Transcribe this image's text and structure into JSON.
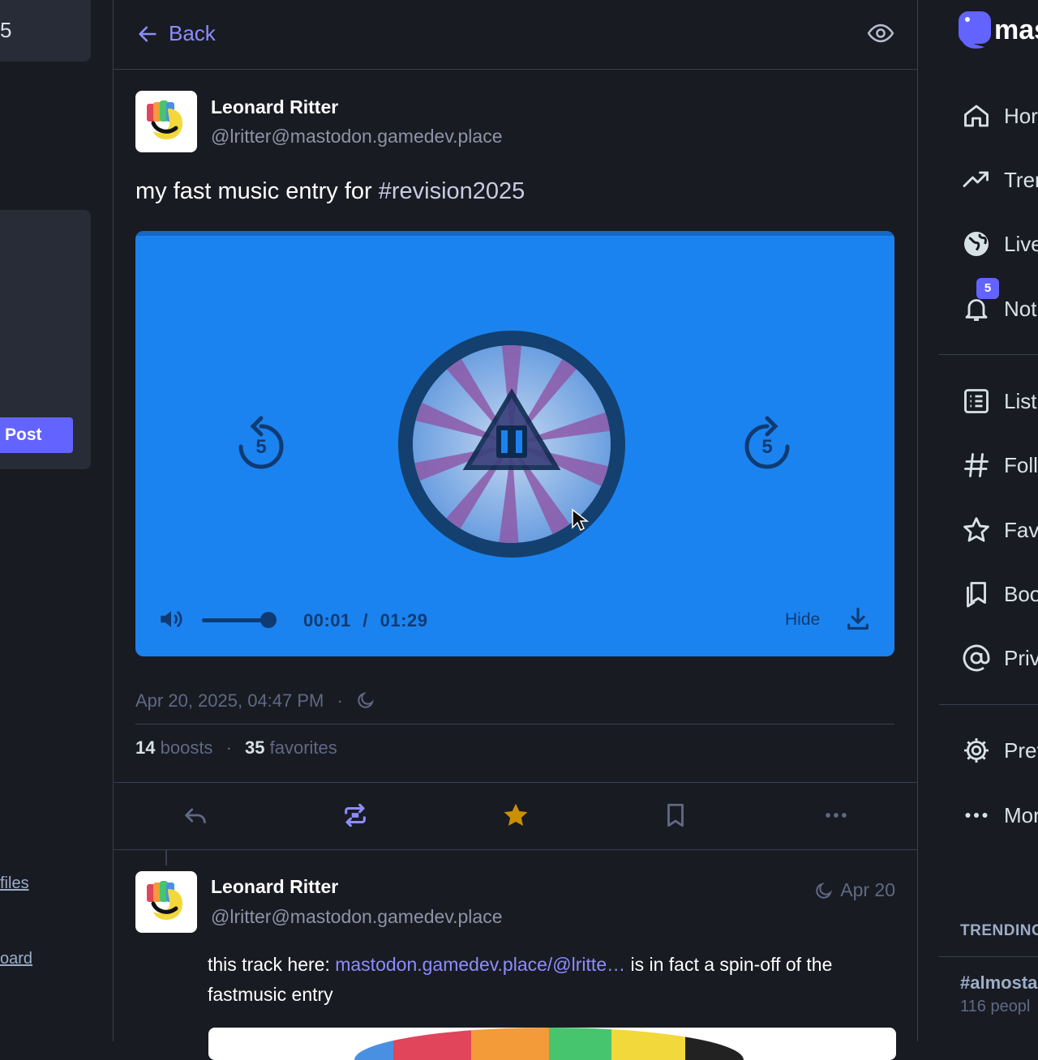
{
  "left": {
    "top_number": "5",
    "post_button": "Post",
    "link_1": "files",
    "link_2": "oard"
  },
  "header": {
    "back_label": "Back"
  },
  "post": {
    "author_name": "Leonard Ritter",
    "author_handle": "@lritter@mastodon.gamedev.place",
    "text_plain": "my fast music entry for ",
    "hashtag": "#revision2025",
    "player": {
      "time_current": "00:01",
      "time_separator": "/",
      "time_total": "01:29",
      "hide_label": "Hide",
      "skip_seconds": "5",
      "volume_level": 1.0,
      "background_color": "#1b83f0"
    },
    "timestamp": "Apr 20, 2025, 04:47 PM",
    "separator": "·",
    "boosts_count": "14",
    "boosts_label": "boosts",
    "favorites_count": "35",
    "favorites_label": "favorites"
  },
  "actions": [
    {
      "name": "reply",
      "icon": "reply-icon"
    },
    {
      "name": "boost",
      "icon": "boost-icon"
    },
    {
      "name": "favorite",
      "icon": "star-icon"
    },
    {
      "name": "bookmark",
      "icon": "bookmark-icon"
    },
    {
      "name": "more",
      "icon": "ellipsis-icon"
    }
  ],
  "reply": {
    "author_name": "Leonard Ritter",
    "author_handle": "@lritter@mastodon.gamedev.place",
    "date": "Apr 20",
    "text_before": "this track here: ",
    "link_text": "mastodon.gamedev.place/@lritte…",
    "text_after": " is in fact a spin-off of the fastmusic entry"
  },
  "sidebar": {
    "logo_text": "mast",
    "items": [
      {
        "label": "Hor",
        "icon": "home-icon"
      },
      {
        "label": "Trer",
        "icon": "trending-icon"
      },
      {
        "label": "Live",
        "icon": "globe-icon"
      },
      {
        "label": "Not",
        "icon": "bell-icon"
      },
      {
        "label": "List",
        "icon": "list-icon"
      },
      {
        "label": "Foll",
        "icon": "hashtag-icon"
      },
      {
        "label": "Fav",
        "icon": "star-outline-icon"
      },
      {
        "label": "Boo",
        "icon": "bookmarks-icon"
      },
      {
        "label": "Priv",
        "icon": "at-icon"
      },
      {
        "label": "Pref",
        "icon": "gear-icon"
      },
      {
        "label": "Mor",
        "icon": "more-icon"
      }
    ],
    "notification_count": "5",
    "trending_header": "TRENDING",
    "trend_tag": "#almosta",
    "trend_sub": "116 peopl"
  },
  "colors": {
    "accent": "#6364ff",
    "background": "#191b22",
    "favorite": "#ca8f04"
  }
}
